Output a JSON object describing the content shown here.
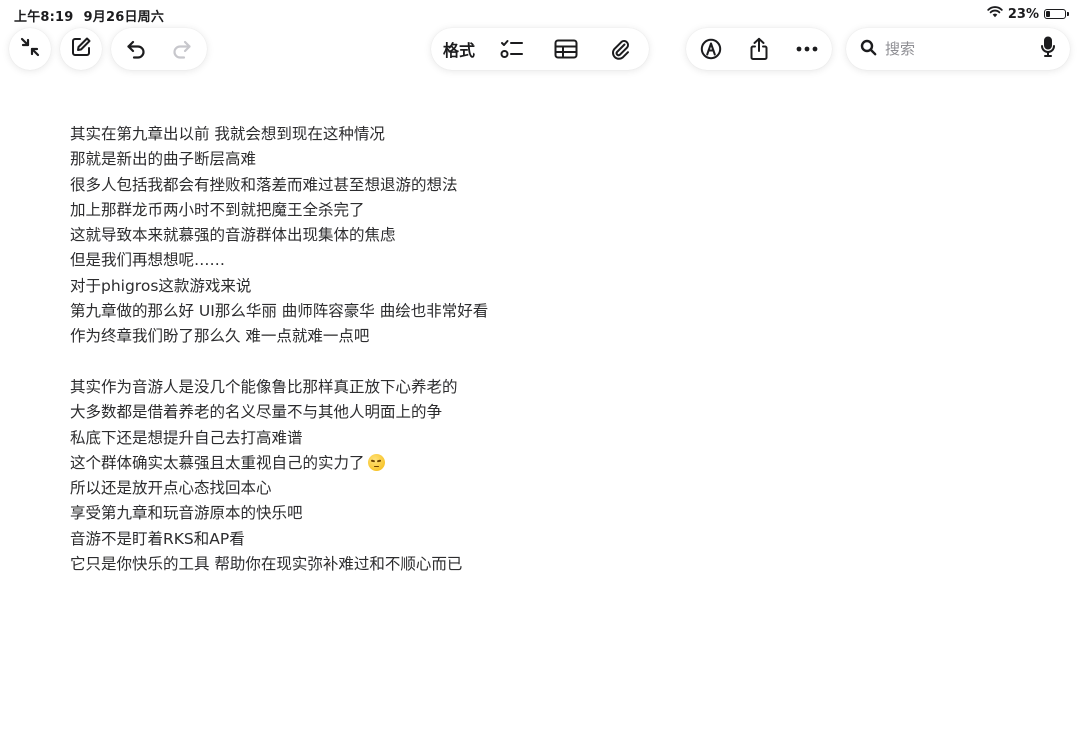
{
  "status_bar": {
    "time": "上午8:19",
    "date": "9月26日周六",
    "battery_percent": "23%",
    "battery_level": 0.23
  },
  "toolbar": {
    "format_label": "格式"
  },
  "search": {
    "placeholder": "搜索"
  },
  "note": {
    "lines": [
      "其实在第九章出以前 我就会想到现在这种情况",
      "那就是新出的曲子断层高难",
      "很多人包括我都会有挫败和落差而难过甚至想退游的想法",
      "加上那群龙币两小时不到就把魔王全杀完了",
      "这就导致本来就慕强的音游群体出现集体的焦虑",
      "但是我们再想想呢……",
      "对于phigros这款游戏来说",
      "第九章做的那么好 UI那么华丽 曲师阵容豪华 曲绘也非常好看",
      "作为终章我们盼了那么久 难一点就难一点吧",
      "",
      "其实作为音游人是没几个能像鲁比那样真正放下心养老的",
      "大多数都是借着养老的名义尽量不与其他人明面上的争",
      "私底下还是想提升自己去打高难谱",
      "这个群体确实太慕强且太重视自己的实力了",
      "所以还是放开点心态找回本心",
      "享受第九章和玩音游原本的快乐吧",
      "音游不是盯着RKS和AP看",
      "它只是你快乐的工具 帮助你在现实弥补难过和不顺心而已"
    ],
    "emoji_line_index": 13,
    "emoji_name": "pensive-face-emoji"
  },
  "colors": {
    "text": "#2c2c2e",
    "icon": "#1c1c1e",
    "disabled_icon": "#c7c7cc",
    "placeholder": "#8e8e93"
  },
  "icons": {
    "collapse": "collapse-arrows-icon",
    "compose": "compose-icon",
    "undo": "undo-icon",
    "redo": "redo-icon",
    "checklist": "checklist-icon",
    "table": "table-icon",
    "attachment": "paperclip-icon",
    "markup": "markup-pen-icon",
    "share": "share-icon",
    "more": "more-icon",
    "search": "search-icon",
    "mic": "microphone-icon"
  }
}
